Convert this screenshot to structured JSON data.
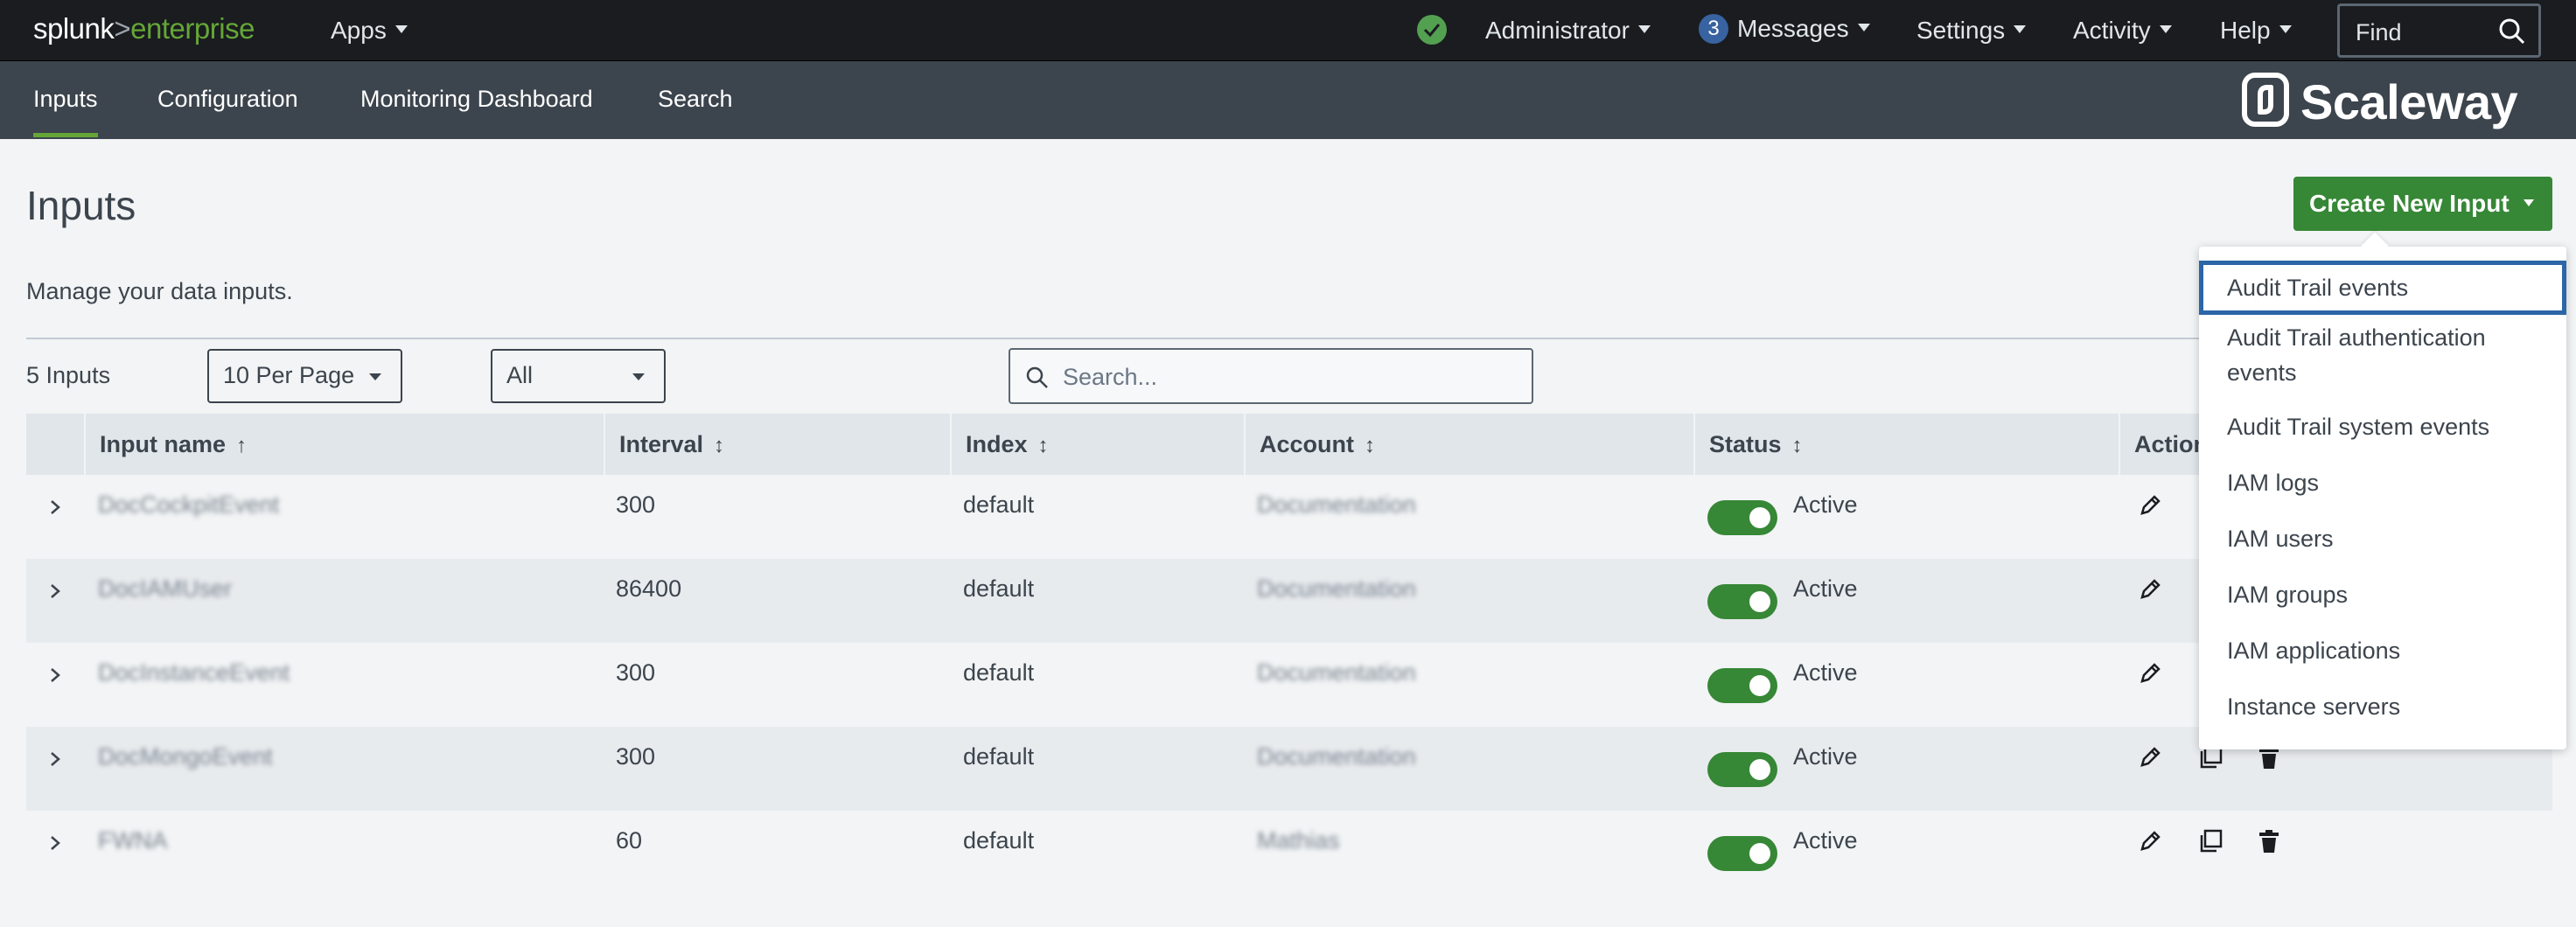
{
  "topbar": {
    "brand_a": "splunk",
    "brand_gt": ">",
    "brand_b": "enterprise",
    "apps": "Apps",
    "user": "Administrator",
    "messages_count": "3",
    "messages": "Messages",
    "settings": "Settings",
    "activity": "Activity",
    "help": "Help",
    "find_placeholder": "Find"
  },
  "nav": {
    "tabs": [
      "Inputs",
      "Configuration",
      "Monitoring Dashboard",
      "Search"
    ],
    "active": "Inputs",
    "logo_text": "Scaleway"
  },
  "page": {
    "title": "Inputs",
    "description": "Manage your data inputs.",
    "create_button": "Create New Input",
    "count": "5 Inputs",
    "per_page": "10 Per Page",
    "filter": "All",
    "search_placeholder": "Search..."
  },
  "table": {
    "headers": [
      "Input name",
      "Interval",
      "Index",
      "Account",
      "Status",
      "Actions"
    ],
    "rows": [
      {
        "name": "DocCockpitEvent",
        "interval": "300",
        "index": "default",
        "account": "Documentation",
        "status": "Active"
      },
      {
        "name": "DocIAMUser",
        "interval": "86400",
        "index": "default",
        "account": "Documentation",
        "status": "Active"
      },
      {
        "name": "DocInstanceEvent",
        "interval": "300",
        "index": "default",
        "account": "Documentation",
        "status": "Active"
      },
      {
        "name": "DocMongoEvent",
        "interval": "300",
        "index": "default",
        "account": "Documentation",
        "status": "Active"
      },
      {
        "name": "FWNA",
        "interval": "60",
        "index": "default",
        "account": "Mathias",
        "status": "Active"
      }
    ]
  },
  "dropdown": {
    "items": [
      "Audit Trail events",
      "Audit Trail authentication events",
      "Audit Trail system events",
      "IAM logs",
      "IAM users",
      "IAM groups",
      "IAM applications",
      "Instance servers"
    ]
  },
  "colors": {
    "topbar": "#1a1c20",
    "navbar": "#3c444d",
    "accent_green": "#368736",
    "focus_blue": "#2c66a7",
    "badge_blue": "#3863a0"
  },
  "icons": [
    "check-icon",
    "search-icon",
    "chevron-right-icon",
    "sort-up-icon",
    "sort-icon",
    "edit-icon",
    "clone-icon",
    "trash-icon",
    "scaleway-logo-icon"
  ]
}
